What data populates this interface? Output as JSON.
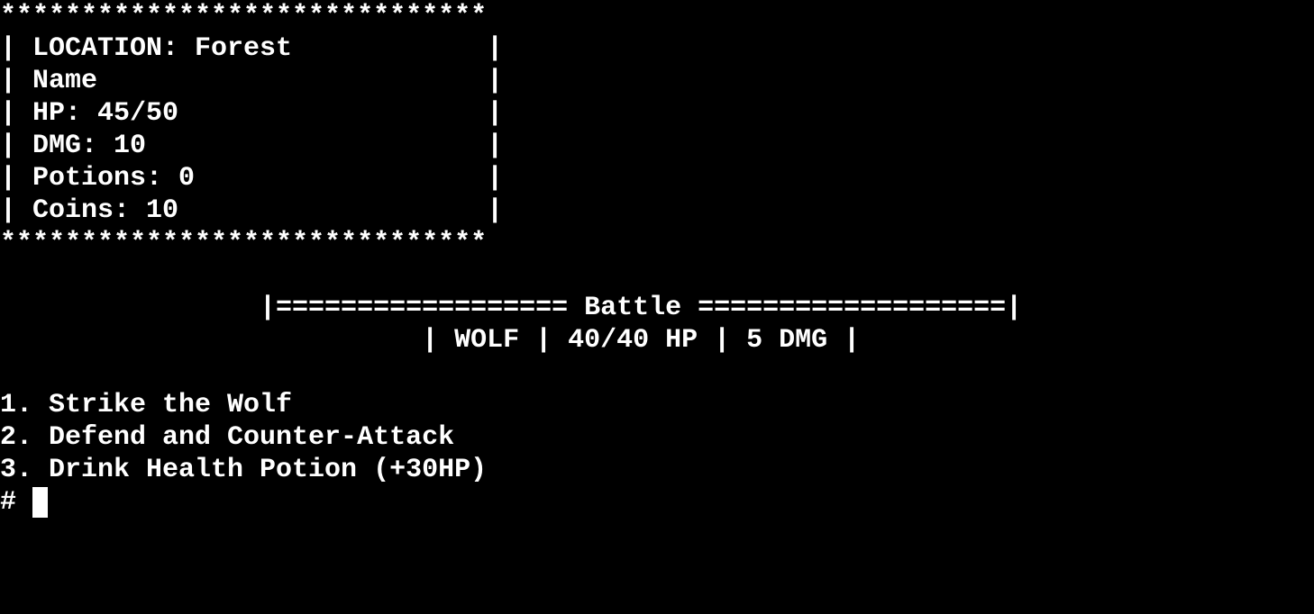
{
  "status_box": {
    "border_top": "******************************",
    "lines": [
      "| LOCATION: Forest            |",
      "| Name                        |",
      "| HP: 45/50                   |",
      "| DMG: 10                     |",
      "| Potions: 0                  |",
      "| Coins: 10                   |"
    ],
    "border_bottom": "******************************"
  },
  "battle": {
    "header": "                |================== Battle ===================|",
    "enemy_line": "                          | WOLF | 40/40 HP | 5 DMG |"
  },
  "menu": {
    "options": [
      "1. Strike the Wolf",
      "2. Defend and Counter-Attack",
      "3. Drink Health Potion (+30HP)"
    ]
  },
  "prompt": {
    "symbol": "# "
  },
  "colors": {
    "background": "#000000",
    "text": "#ffffff"
  }
}
